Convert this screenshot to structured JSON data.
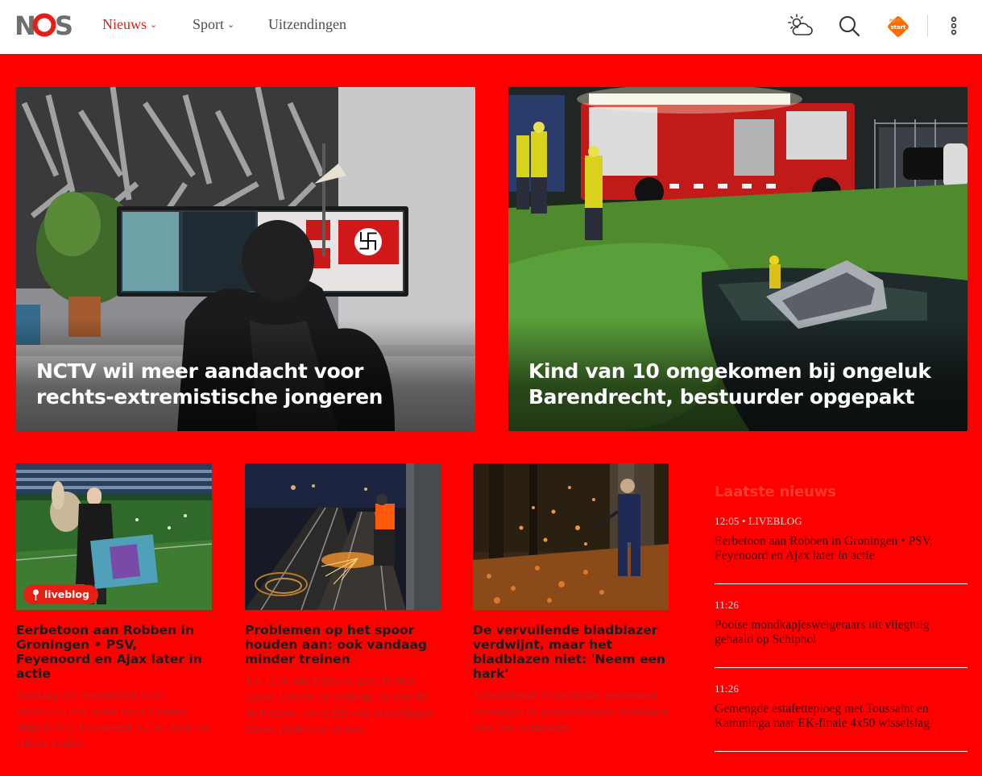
{
  "header": {
    "nav": [
      {
        "label": "Nieuws",
        "has_chevron": true,
        "active": true
      },
      {
        "label": "Sport",
        "has_chevron": true,
        "active": false
      },
      {
        "label": "Uitzendingen",
        "has_chevron": false,
        "active": false
      }
    ],
    "chevron": "⌄",
    "icons": [
      "weather-icon",
      "search-icon",
      "npo-start-icon",
      "more-options-icon"
    ]
  },
  "hero": [
    {
      "title": "NCTV wil meer aandacht voor rechts-extremistische jongeren"
    },
    {
      "title": "Kind van 10 omgekomen bij ongeluk Barendrecht, bestuurder opgepakt"
    }
  ],
  "cards": [
    {
      "badge": "liveblog",
      "title": "Eerbetoon aan Robben in Groningen • PSV, Feyenoord en Ajax later in actie",
      "desc": "Vandaag vijf wedstrijden in de eredivisie, met onder meer Fortuna Sittard-PSV, Feyenoord-AZ en Ajax-Go Ahead Eagles."
    },
    {
      "title": "Problemen op het spoor houden aan: ook vandaag minder treinen",
      "desc": "Tot 15.00 uur rijden er geen treinen tussen Utrecht en Arnhem, en Utrecht en Rhenen. En er zijn ook beperkingen tussen Barneveld en Ede."
    },
    {
      "title": "De vervuilende bladblazer verdwijnt, maar het bladblazen niet: 'Neem een hark'",
      "desc": "Verschillende Nederlandse gemeenten vervangen de gemotoriseerde bladblazer voor een accublazer."
    }
  ],
  "latest": {
    "heading": "Laatste nieuws",
    "items": [
      {
        "meta": "12:05 • LIVEBLOG",
        "text": "Eerbetoon aan Robben in Groningen • PSV, Feyenoord en Ajax later in actie"
      },
      {
        "meta": "11:26",
        "text": "Poolse mondkapjesweigeraars uit vliegtuig gehaald op Schiphol"
      },
      {
        "meta": "11:26",
        "text": "Gemengde estafetteploeg met Toussaint en Kamminga naar EK-finale 4x50 wisselslag"
      }
    ]
  },
  "colors": {
    "accent": "#e61e14",
    "background": "#ff0000"
  }
}
